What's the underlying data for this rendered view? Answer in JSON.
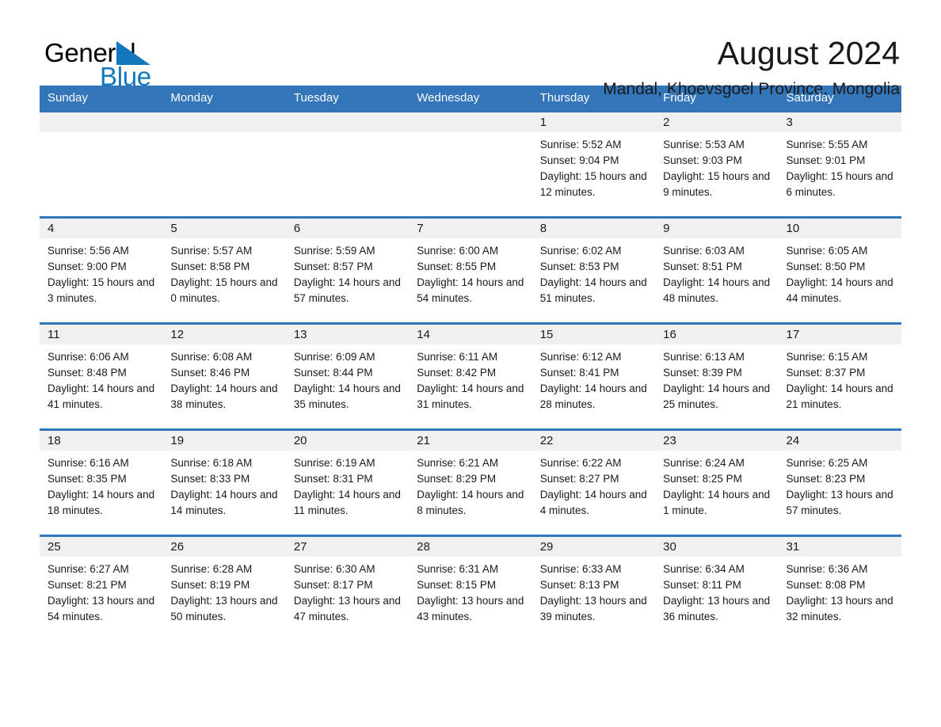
{
  "brand": {
    "name_part1": "General",
    "name_part2": "Blue",
    "accent_color": "#1277bc"
  },
  "header": {
    "title": "August 2024",
    "location": "Mandal, Khoevsgoel Province, Mongolia"
  },
  "calendar": {
    "header_color": "#3275b8",
    "daynum_strip_color": "#f0f0f0",
    "weekday_headers": [
      "Sunday",
      "Monday",
      "Tuesday",
      "Wednesday",
      "Thursday",
      "Friday",
      "Saturday"
    ],
    "weeks": [
      [
        {
          "day": "",
          "sunrise": "",
          "sunset": "",
          "daylight": "",
          "empty": true
        },
        {
          "day": "",
          "sunrise": "",
          "sunset": "",
          "daylight": "",
          "empty": true
        },
        {
          "day": "",
          "sunrise": "",
          "sunset": "",
          "daylight": "",
          "empty": true
        },
        {
          "day": "",
          "sunrise": "",
          "sunset": "",
          "daylight": "",
          "empty": true
        },
        {
          "day": "1",
          "sunrise": "Sunrise: 5:52 AM",
          "sunset": "Sunset: 9:04 PM",
          "daylight": "Daylight: 15 hours and 12 minutes.",
          "empty": false
        },
        {
          "day": "2",
          "sunrise": "Sunrise: 5:53 AM",
          "sunset": "Sunset: 9:03 PM",
          "daylight": "Daylight: 15 hours and 9 minutes.",
          "empty": false
        },
        {
          "day": "3",
          "sunrise": "Sunrise: 5:55 AM",
          "sunset": "Sunset: 9:01 PM",
          "daylight": "Daylight: 15 hours and 6 minutes.",
          "empty": false
        }
      ],
      [
        {
          "day": "4",
          "sunrise": "Sunrise: 5:56 AM",
          "sunset": "Sunset: 9:00 PM",
          "daylight": "Daylight: 15 hours and 3 minutes.",
          "empty": false
        },
        {
          "day": "5",
          "sunrise": "Sunrise: 5:57 AM",
          "sunset": "Sunset: 8:58 PM",
          "daylight": "Daylight: 15 hours and 0 minutes.",
          "empty": false
        },
        {
          "day": "6",
          "sunrise": "Sunrise: 5:59 AM",
          "sunset": "Sunset: 8:57 PM",
          "daylight": "Daylight: 14 hours and 57 minutes.",
          "empty": false
        },
        {
          "day": "7",
          "sunrise": "Sunrise: 6:00 AM",
          "sunset": "Sunset: 8:55 PM",
          "daylight": "Daylight: 14 hours and 54 minutes.",
          "empty": false
        },
        {
          "day": "8",
          "sunrise": "Sunrise: 6:02 AM",
          "sunset": "Sunset: 8:53 PM",
          "daylight": "Daylight: 14 hours and 51 minutes.",
          "empty": false
        },
        {
          "day": "9",
          "sunrise": "Sunrise: 6:03 AM",
          "sunset": "Sunset: 8:51 PM",
          "daylight": "Daylight: 14 hours and 48 minutes.",
          "empty": false
        },
        {
          "day": "10",
          "sunrise": "Sunrise: 6:05 AM",
          "sunset": "Sunset: 8:50 PM",
          "daylight": "Daylight: 14 hours and 44 minutes.",
          "empty": false
        }
      ],
      [
        {
          "day": "11",
          "sunrise": "Sunrise: 6:06 AM",
          "sunset": "Sunset: 8:48 PM",
          "daylight": "Daylight: 14 hours and 41 minutes.",
          "empty": false
        },
        {
          "day": "12",
          "sunrise": "Sunrise: 6:08 AM",
          "sunset": "Sunset: 8:46 PM",
          "daylight": "Daylight: 14 hours and 38 minutes.",
          "empty": false
        },
        {
          "day": "13",
          "sunrise": "Sunrise: 6:09 AM",
          "sunset": "Sunset: 8:44 PM",
          "daylight": "Daylight: 14 hours and 35 minutes.",
          "empty": false
        },
        {
          "day": "14",
          "sunrise": "Sunrise: 6:11 AM",
          "sunset": "Sunset: 8:42 PM",
          "daylight": "Daylight: 14 hours and 31 minutes.",
          "empty": false
        },
        {
          "day": "15",
          "sunrise": "Sunrise: 6:12 AM",
          "sunset": "Sunset: 8:41 PM",
          "daylight": "Daylight: 14 hours and 28 minutes.",
          "empty": false
        },
        {
          "day": "16",
          "sunrise": "Sunrise: 6:13 AM",
          "sunset": "Sunset: 8:39 PM",
          "daylight": "Daylight: 14 hours and 25 minutes.",
          "empty": false
        },
        {
          "day": "17",
          "sunrise": "Sunrise: 6:15 AM",
          "sunset": "Sunset: 8:37 PM",
          "daylight": "Daylight: 14 hours and 21 minutes.",
          "empty": false
        }
      ],
      [
        {
          "day": "18",
          "sunrise": "Sunrise: 6:16 AM",
          "sunset": "Sunset: 8:35 PM",
          "daylight": "Daylight: 14 hours and 18 minutes.",
          "empty": false
        },
        {
          "day": "19",
          "sunrise": "Sunrise: 6:18 AM",
          "sunset": "Sunset: 8:33 PM",
          "daylight": "Daylight: 14 hours and 14 minutes.",
          "empty": false
        },
        {
          "day": "20",
          "sunrise": "Sunrise: 6:19 AM",
          "sunset": "Sunset: 8:31 PM",
          "daylight": "Daylight: 14 hours and 11 minutes.",
          "empty": false
        },
        {
          "day": "21",
          "sunrise": "Sunrise: 6:21 AM",
          "sunset": "Sunset: 8:29 PM",
          "daylight": "Daylight: 14 hours and 8 minutes.",
          "empty": false
        },
        {
          "day": "22",
          "sunrise": "Sunrise: 6:22 AM",
          "sunset": "Sunset: 8:27 PM",
          "daylight": "Daylight: 14 hours and 4 minutes.",
          "empty": false
        },
        {
          "day": "23",
          "sunrise": "Sunrise: 6:24 AM",
          "sunset": "Sunset: 8:25 PM",
          "daylight": "Daylight: 14 hours and 1 minute.",
          "empty": false
        },
        {
          "day": "24",
          "sunrise": "Sunrise: 6:25 AM",
          "sunset": "Sunset: 8:23 PM",
          "daylight": "Daylight: 13 hours and 57 minutes.",
          "empty": false
        }
      ],
      [
        {
          "day": "25",
          "sunrise": "Sunrise: 6:27 AM",
          "sunset": "Sunset: 8:21 PM",
          "daylight": "Daylight: 13 hours and 54 minutes.",
          "empty": false
        },
        {
          "day": "26",
          "sunrise": "Sunrise: 6:28 AM",
          "sunset": "Sunset: 8:19 PM",
          "daylight": "Daylight: 13 hours and 50 minutes.",
          "empty": false
        },
        {
          "day": "27",
          "sunrise": "Sunrise: 6:30 AM",
          "sunset": "Sunset: 8:17 PM",
          "daylight": "Daylight: 13 hours and 47 minutes.",
          "empty": false
        },
        {
          "day": "28",
          "sunrise": "Sunrise: 6:31 AM",
          "sunset": "Sunset: 8:15 PM",
          "daylight": "Daylight: 13 hours and 43 minutes.",
          "empty": false
        },
        {
          "day": "29",
          "sunrise": "Sunrise: 6:33 AM",
          "sunset": "Sunset: 8:13 PM",
          "daylight": "Daylight: 13 hours and 39 minutes.",
          "empty": false
        },
        {
          "day": "30",
          "sunrise": "Sunrise: 6:34 AM",
          "sunset": "Sunset: 8:11 PM",
          "daylight": "Daylight: 13 hours and 36 minutes.",
          "empty": false
        },
        {
          "day": "31",
          "sunrise": "Sunrise: 6:36 AM",
          "sunset": "Sunset: 8:08 PM",
          "daylight": "Daylight: 13 hours and 32 minutes.",
          "empty": false
        }
      ]
    ]
  }
}
